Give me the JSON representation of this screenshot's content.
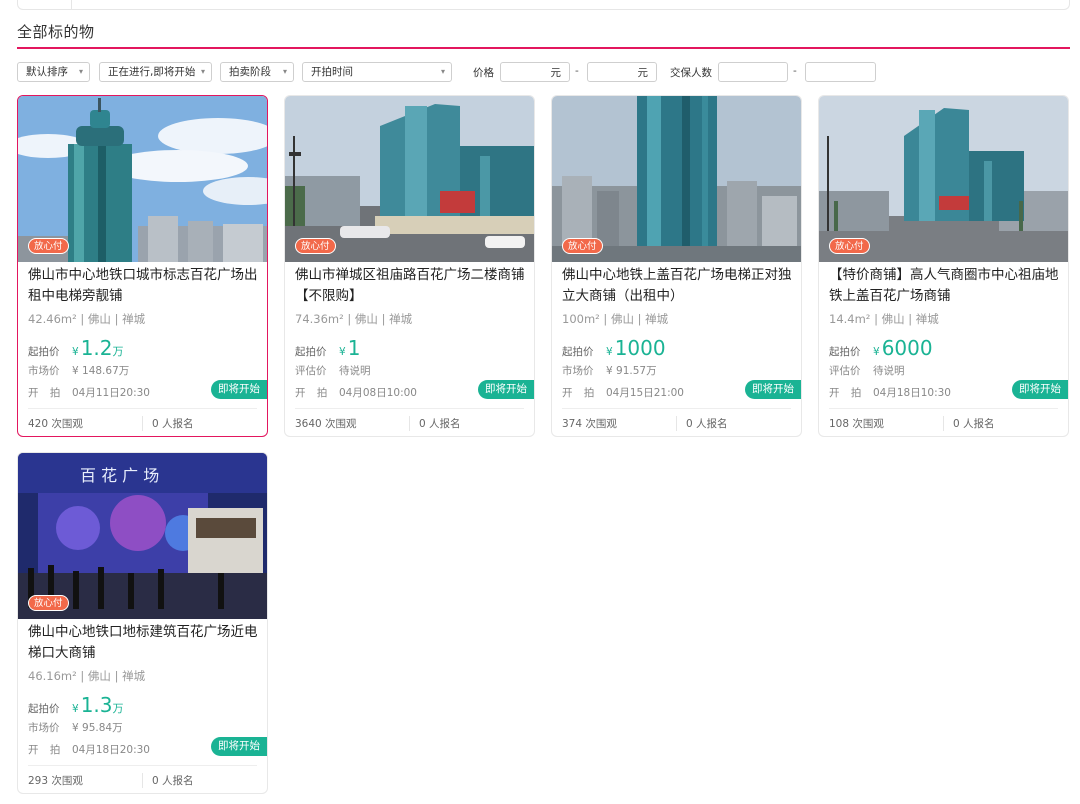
{
  "section_title": "全部标的物",
  "filters": {
    "sort": "默认排序",
    "status": "正在进行,即将开始",
    "stage": "拍卖阶段",
    "start_time": "开拍时间",
    "price_label": "价格",
    "price_unit": "元",
    "dash": "-",
    "deposit_label": "交保人数"
  },
  "labels": {
    "badge": "放心付",
    "start_price": "起拍价",
    "market_price": "市场价",
    "est_price": "评估价",
    "start_time": "开 拍",
    "yen": "¥",
    "go": "即将开始",
    "views_suffix": "次围观",
    "signup_suffix": "人报名"
  },
  "cards": [
    {
      "title": "佛山市中心地铁口城市标志百花广场出租中电梯旁靓铺",
      "meta": "42.46m² | 佛山 | 禅城",
      "start_price": "1.2",
      "start_unit": "万",
      "second_label": "市场价",
      "second_value": "¥ 148.67万",
      "time": "04月11日20:30",
      "views": "420 次围观",
      "signups": "0 人报名",
      "image": "tower-skyline-icon",
      "sky": "#6fa3d8"
    },
    {
      "title": "佛山市禅城区祖庙路百花广场二楼商铺【不限购】",
      "meta": "74.36m² | 佛山 | 禅城",
      "start_price": "1",
      "start_unit": "",
      "second_label": "评估价",
      "second_value": "待说明",
      "time": "04月08日10:00",
      "views": "3640 次围观",
      "signups": "0 人报名",
      "image": "street-tower-icon",
      "sky": "#c9d6e2"
    },
    {
      "title": "佛山中心地铁上盖百花广场电梯正对独立大商铺（出租中）",
      "meta": "100m² | 佛山 | 禅城",
      "start_price": "1000",
      "start_unit": "",
      "second_label": "市场价",
      "second_value": "¥ 91.57万",
      "time": "04月15日21:00",
      "views": "374 次围观",
      "signups": "0 人报名",
      "image": "aerial-tower-icon",
      "sky": "#b7c6d4"
    },
    {
      "title": "【特价商铺】高人气商圈市中心祖庙地铁上盖百花广场商铺",
      "meta": "14.4m² | 佛山 | 禅城",
      "start_price": "6000",
      "start_unit": "",
      "second_label": "评估价",
      "second_value": "待说明",
      "time": "04月18日10:30",
      "views": "108 次围观",
      "signups": "0 人报名",
      "image": "plaza-tower-icon",
      "sky": "#cdd8e3"
    },
    {
      "title": "佛山中心地铁口地标建筑百花广场近电梯口大商铺",
      "meta": "46.16m² | 佛山 | 禅城",
      "start_price": "1.3",
      "start_unit": "万",
      "second_label": "市场价",
      "second_value": "¥ 95.84万",
      "time": "04月18日20:30",
      "views": "293 次围观",
      "signups": "0 人报名",
      "image": "night-entrance-icon",
      "sky": "#1e2a6b",
      "sign_text": "百 花 广 场"
    }
  ]
}
